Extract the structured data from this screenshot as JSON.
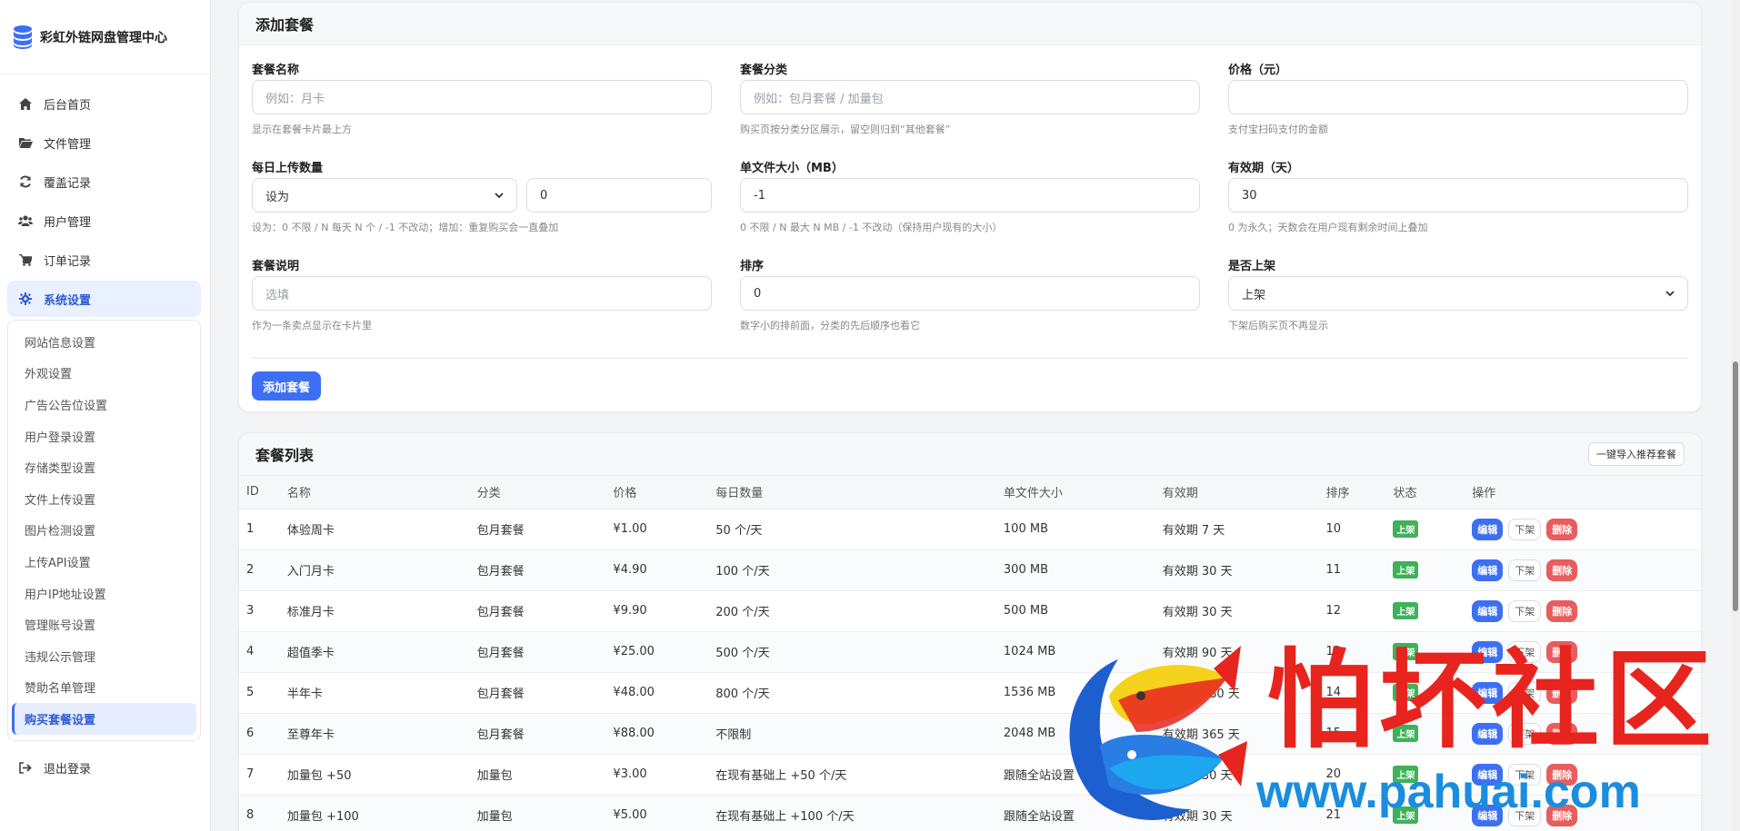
{
  "brand": {
    "title": "彩虹外链网盘管理中心"
  },
  "nav": {
    "items": [
      {
        "label": "后台首页",
        "icon": "home-icon"
      },
      {
        "label": "文件管理",
        "icon": "folder-icon"
      },
      {
        "label": "覆盖记录",
        "icon": "refresh-icon"
      },
      {
        "label": "用户管理",
        "icon": "users-icon"
      },
      {
        "label": "订单记录",
        "icon": "cart-icon"
      },
      {
        "label": "系统设置",
        "icon": "gear-icon"
      }
    ],
    "sub_items": [
      "网站信息设置",
      "外观设置",
      "广告公告位设置",
      "用户登录设置",
      "存储类型设置",
      "文件上传设置",
      "图片检测设置",
      "上传API设置",
      "用户IP地址设置",
      "管理账号设置",
      "违规公示管理",
      "赞助名单管理",
      "购买套餐设置"
    ],
    "logout": "退出登录"
  },
  "form": {
    "title": "添加套餐",
    "name": {
      "label": "套餐名称",
      "placeholder": "例如：月卡",
      "hint": "显示在套餐卡片最上方"
    },
    "category": {
      "label": "套餐分类",
      "placeholder": "例如：包月套餐 / 加量包",
      "hint": "购买页按分类分区展示，留空则归到“其他套餐”"
    },
    "price": {
      "label": "价格（元）",
      "value": "",
      "hint": "支付宝扫码支付的金额"
    },
    "daily": {
      "label": "每日上传数量",
      "mode": "设为",
      "value": "0",
      "hint": "设为：0 不限 / N 每天 N 个 / -1 不改动；增加：重复购买会一直叠加"
    },
    "filesize": {
      "label": "单文件大小（MB）",
      "value": "-1",
      "hint": "0 不限 / N 最大 N MB / -1 不改动（保持用户现有的大小）"
    },
    "validity": {
      "label": "有效期（天）",
      "value": "30",
      "hint": "0 为永久；天数会在用户现有剩余时间上叠加"
    },
    "desc": {
      "label": "套餐说明",
      "placeholder": "选填",
      "hint": "作为一条卖点显示在卡片里"
    },
    "sort": {
      "label": "排序",
      "value": "0",
      "hint": "数字小的排前面，分类的先后顺序也看它"
    },
    "listed": {
      "label": "是否上架",
      "value": "上架",
      "hint": "下架后购买页不再显示"
    },
    "submit": "添加套餐"
  },
  "list": {
    "title": "套餐列表",
    "import_button": "一键导入推荐套餐",
    "columns": [
      "ID",
      "名称",
      "分类",
      "价格",
      "每日数量",
      "单文件大小",
      "有效期",
      "排序",
      "状态",
      "操作"
    ],
    "rows": [
      {
        "id": "1",
        "name": "体验周卡",
        "category": "包月套餐",
        "price": "¥1.00",
        "daily": "50 个/天",
        "size": "100 MB",
        "validity": "有效期 7 天",
        "sort": "10",
        "status": "上架"
      },
      {
        "id": "2",
        "name": "入门月卡",
        "category": "包月套餐",
        "price": "¥4.90",
        "daily": "100 个/天",
        "size": "300 MB",
        "validity": "有效期 30 天",
        "sort": "11",
        "status": "上架"
      },
      {
        "id": "3",
        "name": "标准月卡",
        "category": "包月套餐",
        "price": "¥9.90",
        "daily": "200 个/天",
        "size": "500 MB",
        "validity": "有效期 30 天",
        "sort": "12",
        "status": "上架"
      },
      {
        "id": "4",
        "name": "超值季卡",
        "category": "包月套餐",
        "price": "¥25.00",
        "daily": "500 个/天",
        "size": "1024 MB",
        "validity": "有效期 90 天",
        "sort": "13",
        "status": "上架"
      },
      {
        "id": "5",
        "name": "半年卡",
        "category": "包月套餐",
        "price": "¥48.00",
        "daily": "800 个/天",
        "size": "1536 MB",
        "validity": "有效期 180 天",
        "sort": "14",
        "status": "上架"
      },
      {
        "id": "6",
        "name": "至尊年卡",
        "category": "包月套餐",
        "price": "¥88.00",
        "daily": "不限制",
        "size": "2048 MB",
        "validity": "有效期 365 天",
        "sort": "15",
        "status": "上架"
      },
      {
        "id": "7",
        "name": "加量包 +50",
        "category": "加量包",
        "price": "¥3.00",
        "daily": "在现有基础上 +50 个/天",
        "size": "跟随全站设置",
        "validity": "有效期 30 天",
        "sort": "20",
        "status": "上架"
      },
      {
        "id": "8",
        "name": "加量包 +100",
        "category": "加量包",
        "price": "¥5.00",
        "daily": "在现有基础上 +100 个/天",
        "size": "跟随全站设置",
        "validity": "有效期 30 天",
        "sort": "21",
        "status": "上架"
      }
    ],
    "actions": {
      "edit": "编辑",
      "down": "下架",
      "delete": "删除"
    }
  },
  "watermark": {
    "text": "怕坏社区",
    "url": "www.pahuai.com"
  },
  "colors": {
    "primary": "#3c6ff2",
    "danger": "#e85d5d",
    "success": "#3fb15a",
    "active_bg": "#e9f0ff"
  }
}
